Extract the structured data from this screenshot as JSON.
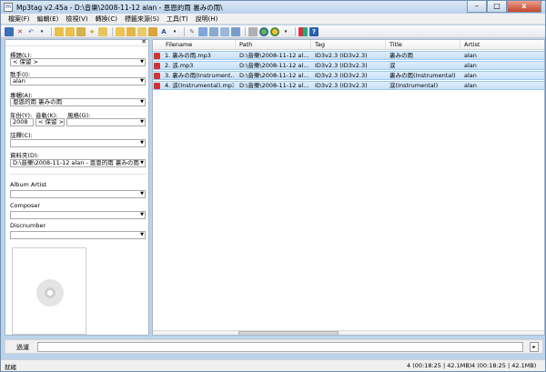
{
  "window": {
    "title": "Mp3tag v2.45a - D:\\音樂\\2008-11-12 alan - 恩恩的雨 裏みの雨\\",
    "app_icon_text": "m",
    "minimize": "–",
    "maximize": "□",
    "close": "x"
  },
  "menu": [
    "檔案(F)",
    "編輯(E)",
    "檢視(V)",
    "轉換(C)",
    "標籤來源(S)",
    "工具(T)",
    "說明(H)"
  ],
  "left_panel": {
    "close_glyph": "✕",
    "title_label": "標題(L):",
    "title_value": "< 保留 >",
    "artist_label": "歌手(I):",
    "artist_value": "alan",
    "album_label": "專輯(A):",
    "album_value": "恩恩的雨 裏みの雨",
    "year_label": "年份(Y):",
    "year_value": "2008",
    "track_label": "音軌(K):",
    "track_value": "< 保留 >",
    "genre_label": "風格(G):",
    "genre_value": "",
    "comment_label": "註釋(C):",
    "comment_value": "",
    "directory_label": "資料夾(D):",
    "directory_value": "D:\\音樂\\2008-11-12 alan - 恩恩的雨 裏みの雨",
    "album_artist_label": "Album Artist",
    "composer_label": "Composer",
    "discnumber_label": "Discnumber"
  },
  "table": {
    "columns": [
      "Filename",
      "Path",
      "Tag",
      "Title",
      "Artist"
    ],
    "rows": [
      {
        "filename": "1. 裏みの雨.mp3",
        "path": "D:\\音樂\\2008-11-12 al...",
        "tag": "ID3v2.3 (ID3v2.3)",
        "title": "裏みの雨",
        "artist": "alan"
      },
      {
        "filename": "2. 涙.mp3",
        "path": "D:\\音樂\\2008-11-12 al...",
        "tag": "ID3v2.3 (ID3v2.3)",
        "title": "涙",
        "artist": "alan"
      },
      {
        "filename": "3. 裏みの雨(Instrument...",
        "path": "D:\\音樂\\2008-11-12 al...",
        "tag": "ID3v2.3 (ID3v2.3)",
        "title": "裏みの雨(Instrumental)",
        "artist": "alan"
      },
      {
        "filename": "4. 涙(Instrumental).mp3",
        "path": "D:\\音樂\\2008-11-12 al...",
        "tag": "ID3v2.3 (ID3v2.3)",
        "title": "涙(Instrumental)",
        "artist": "alan"
      }
    ]
  },
  "filter": {
    "label": "過濾",
    "value": "",
    "go": "▸"
  },
  "status": {
    "left": "就緒",
    "selected": "4 (00:18:25 | 42.1MB)",
    "total": "4 (00:18:25 | 42.1MB)"
  },
  "colors": {
    "selection": "#c6e0f7",
    "window_frame": "#bcd3ec"
  }
}
